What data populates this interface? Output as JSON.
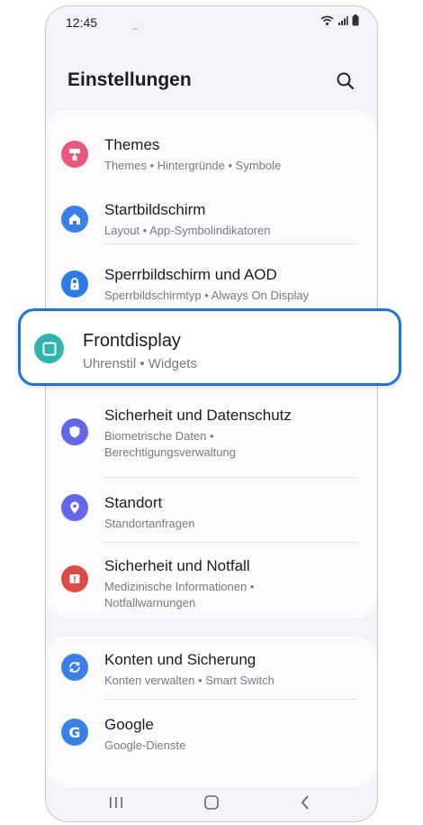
{
  "status": {
    "time": "12:45"
  },
  "header": {
    "title": "Einstellungen"
  },
  "items": [
    {
      "title": "Themes",
      "sub": [
        "Themes • Hintergründe • Symbole"
      ],
      "icon": "paint-roller-icon",
      "color": "#e8587e"
    },
    {
      "title": "Startbildschirm",
      "sub": [
        "Layout • App-Symbolindikatoren"
      ],
      "icon": "home-icon",
      "color": "#3b80e8"
    },
    {
      "title": "Sperrbildschirm und AOD",
      "sub": [
        "Sperrbildschirmtyp • Always On Display"
      ],
      "icon": "lock-icon",
      "color": "#2f7be5"
    },
    {
      "title": "Frontdisplay",
      "sub": [
        "Uhrenstil • Widgets"
      ],
      "icon": "front-display-icon",
      "color": "#2fb4ae"
    },
    {
      "title": "Sicherheit und Datenschutz",
      "sub": [
        "Biometrische Daten •",
        "Berechtigungsverwaltung"
      ],
      "icon": "shield-icon",
      "color": "#6366e6"
    },
    {
      "title": "Standort",
      "sub": [
        "Standortanfragen"
      ],
      "icon": "location-pin-icon",
      "color": "#6366e6"
    },
    {
      "title": "Sicherheit und Notfall",
      "sub": [
        "Medizinische Informationen •",
        "Notfallwarnungen"
      ],
      "icon": "emergency-icon",
      "color": "#e04a46"
    },
    {
      "title": "Konten und Sicherung",
      "sub": [
        "Konten verwalten • Smart Switch"
      ],
      "icon": "sync-icon",
      "color": "#3b80e8"
    },
    {
      "title": "Google",
      "sub": [
        "Google-Dienste"
      ],
      "icon": "google-icon",
      "color": "#3b80e8"
    }
  ],
  "nav": {
    "recents": "recents-icon",
    "home": "home-nav-icon",
    "back": "back-icon"
  }
}
